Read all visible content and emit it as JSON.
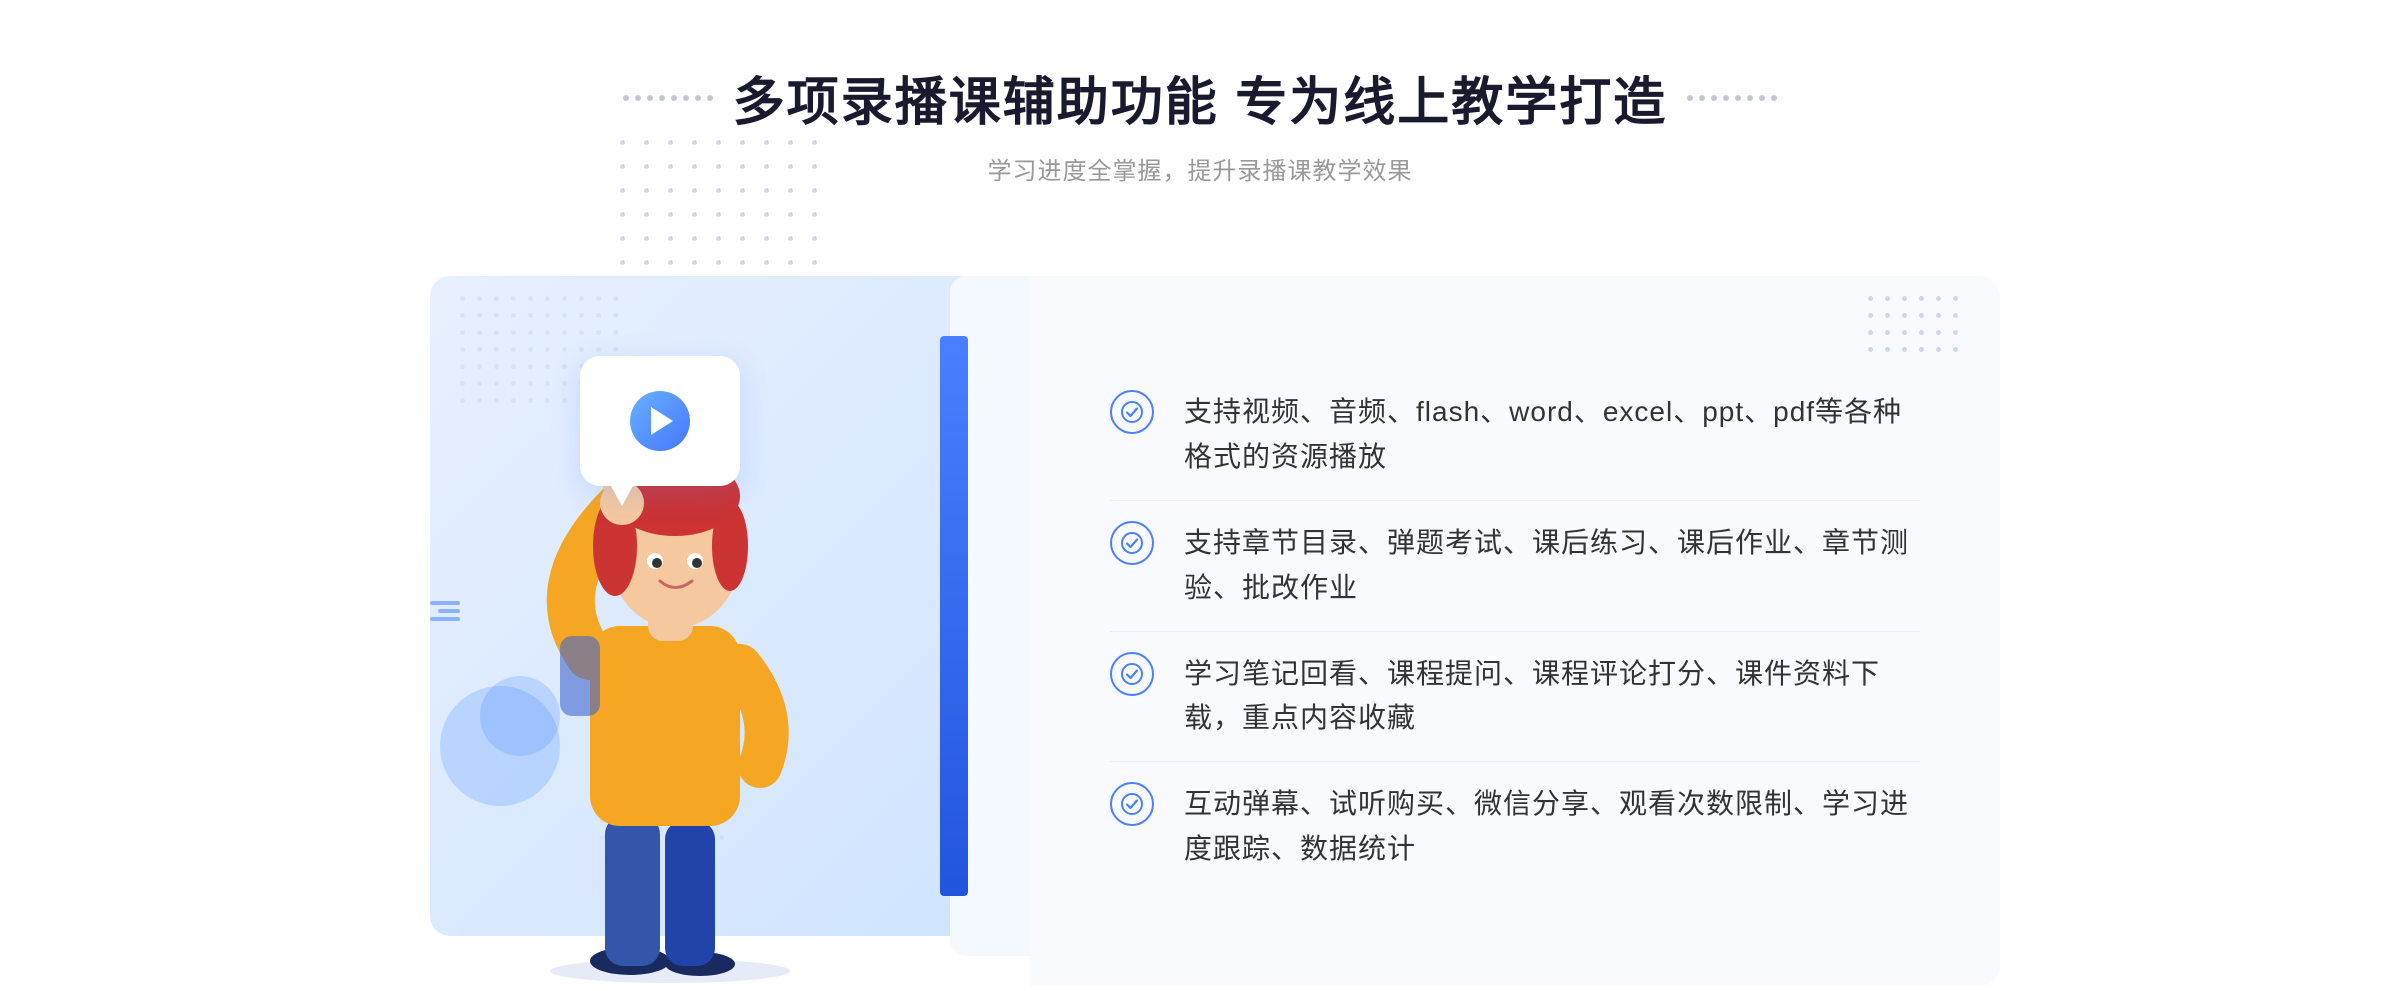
{
  "header": {
    "title": "多项录播课辅助功能 专为线上教学打造",
    "subtitle": "学习进度全掌握，提升录播课教学效果",
    "dots_left": [
      "●",
      "●",
      "●",
      "●"
    ],
    "dots_right": [
      "●",
      "●",
      "●",
      "●"
    ]
  },
  "features": [
    {
      "id": 1,
      "text": "支持视频、音频、flash、word、excel、ppt、pdf等各种格式的资源播放"
    },
    {
      "id": 2,
      "text": "支持章节目录、弹题考试、课后练习、课后作业、章节测验、批改作业"
    },
    {
      "id": 3,
      "text": "学习笔记回看、课程提问、课程评论打分、课件资料下载，重点内容收藏"
    },
    {
      "id": 4,
      "text": "互动弹幕、试听购买、微信分享、观看次数限制、学习进度跟踪、数据统计"
    }
  ],
  "colors": {
    "primary": "#4a7fff",
    "title": "#1a1a2e",
    "subtitle": "#999999",
    "feature_text": "#333333",
    "bg_light": "#f4f8ff",
    "check_color": "#4a7fff"
  }
}
